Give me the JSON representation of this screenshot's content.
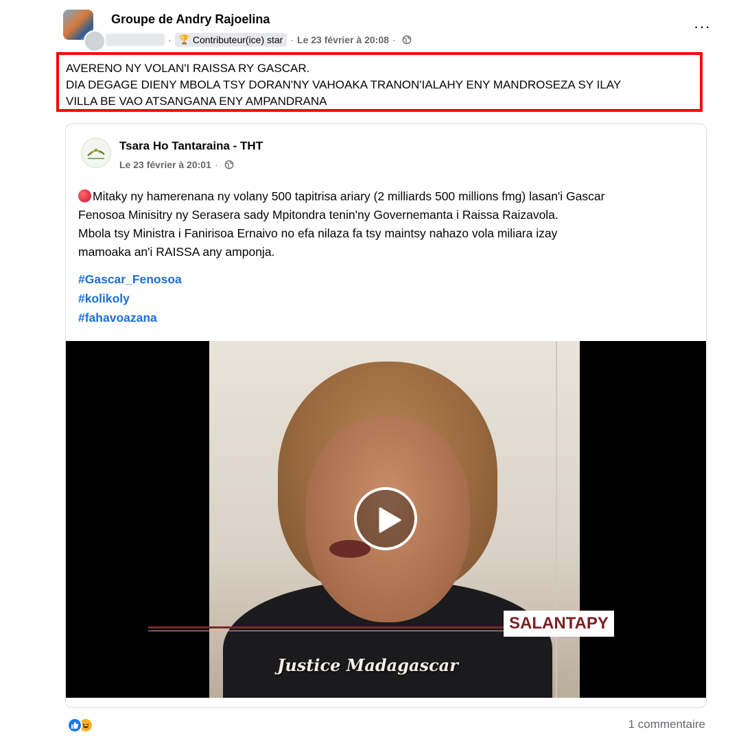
{
  "post": {
    "group_name": "Groupe de Andry Rajoelina",
    "badge_label": "Contributeur(ice) star",
    "separator": "·",
    "date": "Le 23 février à 20:08",
    "more_label": "···",
    "body_lines": [
      "AVERENO NY VOLAN'I RAISSA RY GASCAR.",
      "DIA DEGAGE DIENY MBOLA TSY DORAN'NY VAHOAKA TRANON'IALAHY ENY MANDROSEZA SY ILAY",
      "VILLA BE VAO ATSANGANA ENY AMPANDRANA"
    ],
    "highlight_color": "#ff0000"
  },
  "shared": {
    "page_name": "Tsara Ho Tantaraina - THT",
    "date": "Le 23 février à 20:01",
    "separator": "·",
    "text_lines": [
      "Mitaky ny hamerenana ny volany 500 tapitrisa ariary (2 milliards 500 millions fmg) lasan'i Gascar",
      "Fenosoa Minisitry ny Serasera sady Mpitondra tenin'ny Governemanta i Raissa Raizavola.",
      "Mbola tsy Ministra i Fanirisoa Ernaivo no efa nilaza fa tsy maintsy nahazo vola miliara izay",
      "mamoaka an'i RAISSA any amponja."
    ],
    "hashtags": [
      "#Gascar_Fenosoa",
      "#kolikoly",
      "#fahavoazana"
    ],
    "video": {
      "lower_third": "SALANTAPY",
      "watermark": "Justice Madagascar",
      "play_icon": "play-icon"
    }
  },
  "footer": {
    "reactions": [
      "like-icon",
      "haha-icon"
    ],
    "comments": "1 commentaire"
  },
  "colors": {
    "link": "#1d6fd3",
    "secondary_text": "#65676b",
    "like_blue": "#1877f2"
  }
}
